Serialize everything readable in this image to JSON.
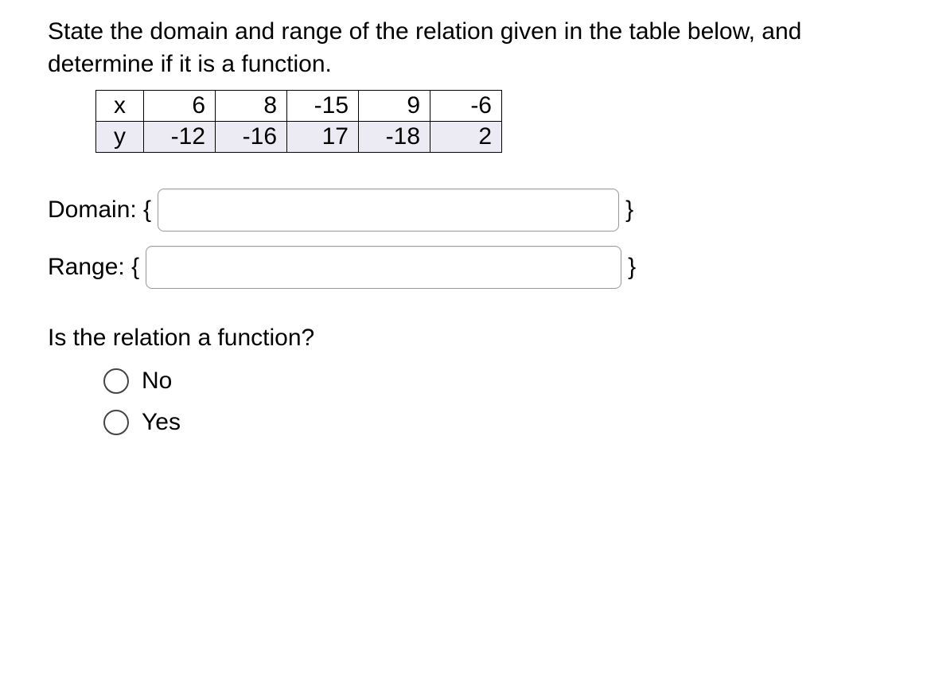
{
  "question": {
    "prompt": "State the domain and range of the relation given in the table below, and determine if it is a function."
  },
  "table": {
    "row_x": {
      "label": "x",
      "values": [
        "6",
        "8",
        "-15",
        "9",
        "-6"
      ]
    },
    "row_y": {
      "label": "y",
      "values": [
        "-12",
        "-16",
        "17",
        "-18",
        "2"
      ]
    }
  },
  "inputs": {
    "domain": {
      "label": "Domain: {",
      "close": "}",
      "value": ""
    },
    "range": {
      "label": "Range: {",
      "close": "}",
      "value": ""
    }
  },
  "sub_question": "Is the relation a function?",
  "options": {
    "no": "No",
    "yes": "Yes"
  }
}
